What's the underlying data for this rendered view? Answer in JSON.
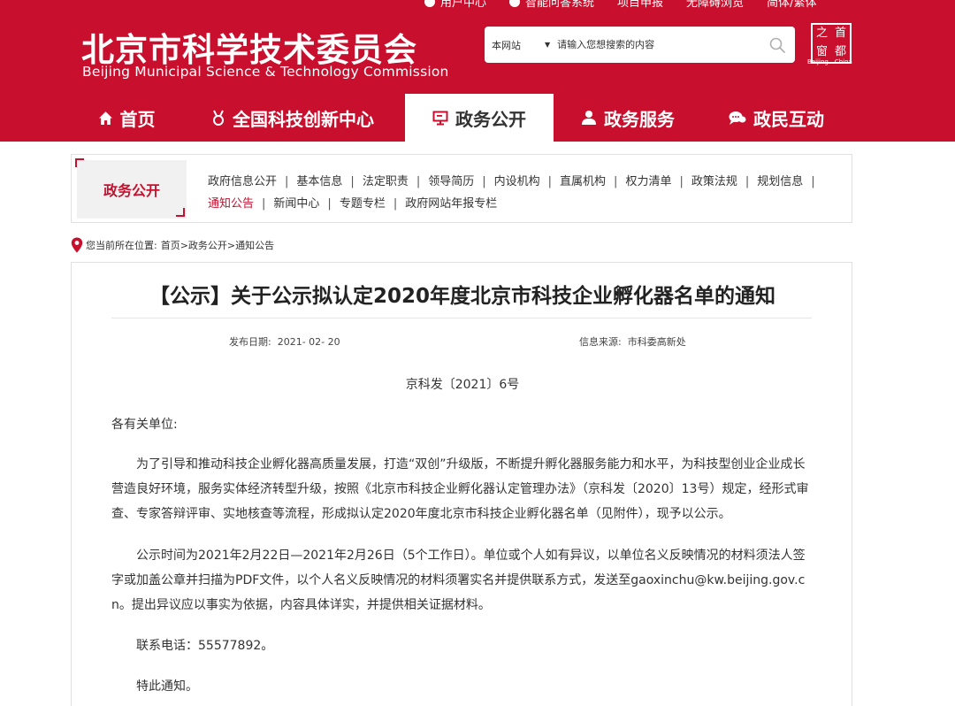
{
  "header": {
    "top_links": [
      "用户中心",
      "智能问答系统",
      "项目申报",
      "无障碍浏览",
      "简体/繁体"
    ],
    "title_cn": "北京市科学技术委员会",
    "title_en": "Beijing Municipal Science & Technology Commission",
    "search": {
      "scope": "本网站",
      "placeholder": "请输入您想搜索的内容"
    },
    "seal": {
      "chars": [
        "之",
        "首",
        "窗",
        "都"
      ],
      "caption": "Beijing—China"
    }
  },
  "nav": {
    "items": [
      {
        "label": "首页",
        "icon": "home-icon"
      },
      {
        "label": "全国科技创新中心",
        "icon": "medal-icon"
      },
      {
        "label": "政务公开",
        "icon": "monitor-icon"
      },
      {
        "label": "政务服务",
        "icon": "person-icon"
      },
      {
        "label": "政民互动",
        "icon": "chat-icon"
      }
    ],
    "active": "政务公开"
  },
  "section": {
    "tag": "政务公开",
    "links": [
      "政府信息公开",
      "基本信息",
      "法定职责",
      "领导简历",
      "内设机构",
      "直属机构",
      "权力清单",
      "政策法规",
      "规划信息",
      "通知公告",
      "新闻中心",
      "专题专栏",
      "政府网站年报专栏"
    ],
    "active": "通知公告"
  },
  "breadcrumb": {
    "label": "您当前所在位置:",
    "path": "首页>政务公开>通知公告"
  },
  "article": {
    "title": "【公示】关于公示拟认定2020年度北京市科技企业孵化器名单的通知",
    "date_label": "发布日期:",
    "date": "2021- 02- 20",
    "source_label": "信息来源:",
    "source": "市科委高新处",
    "doc_no": "京科发〔2021〕6号",
    "salutation": "各有关单位:",
    "paragraphs": [
      "为了引导和推动科技企业孵化器高质量发展，打造“双创”升级版，不断提升孵化器服务能力和水平，为科技型创业企业成长营造良好环境，服务实体经济转型升级，按照《北京市科技企业孵化器认定管理办法》（京科发〔2020〕13号）规定，经形式审查、专家答辩评审、实地核查等流程，形成拟认定2020年度北京市科技企业孵化器名单（见附件），现予以公示。",
      "公示时间为2021年2月22日—2021年2月26日（5个工作日）。单位或个人如有异议，以单位名义反映情况的材料须法人签字或加盖公章并扫描为PDF文件，以个人名义反映情况的材料须署实名并提供联系方式，发送至gaoxinchu@kw.beijing.gov.cn。提出异议应以事实为依据，内容具体详实，并提供相关证据材料。",
      "联系电话：55577892。",
      "特此通知。"
    ]
  },
  "colors": {
    "brand_red": "#c8102e",
    "text": "#333333"
  }
}
